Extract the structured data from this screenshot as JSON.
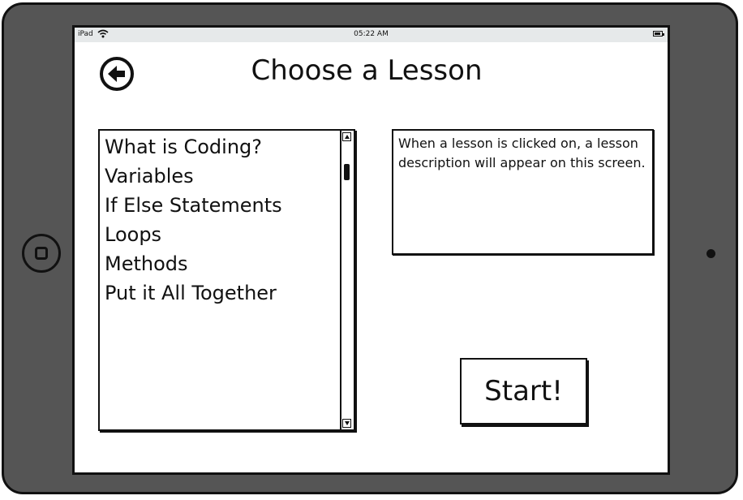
{
  "status_bar": {
    "device": "iPad",
    "time": "05:22 AM"
  },
  "header": {
    "title": "Choose a Lesson",
    "back_icon": "back-arrow-circle-icon"
  },
  "lessons": {
    "items": [
      {
        "label": "What is Coding?"
      },
      {
        "label": "Variables"
      },
      {
        "label": "If Else  Statements"
      },
      {
        "label": "Loops"
      },
      {
        "label": "Methods"
      },
      {
        "label": "Put it All Together"
      }
    ]
  },
  "description": {
    "text": "When a lesson is clicked on, a lesson description will appear on this screen."
  },
  "actions": {
    "start_label": "Start!"
  },
  "colors": {
    "device_frame": "#555555",
    "status_bar": "#e6e9ea",
    "ink": "#111111"
  }
}
